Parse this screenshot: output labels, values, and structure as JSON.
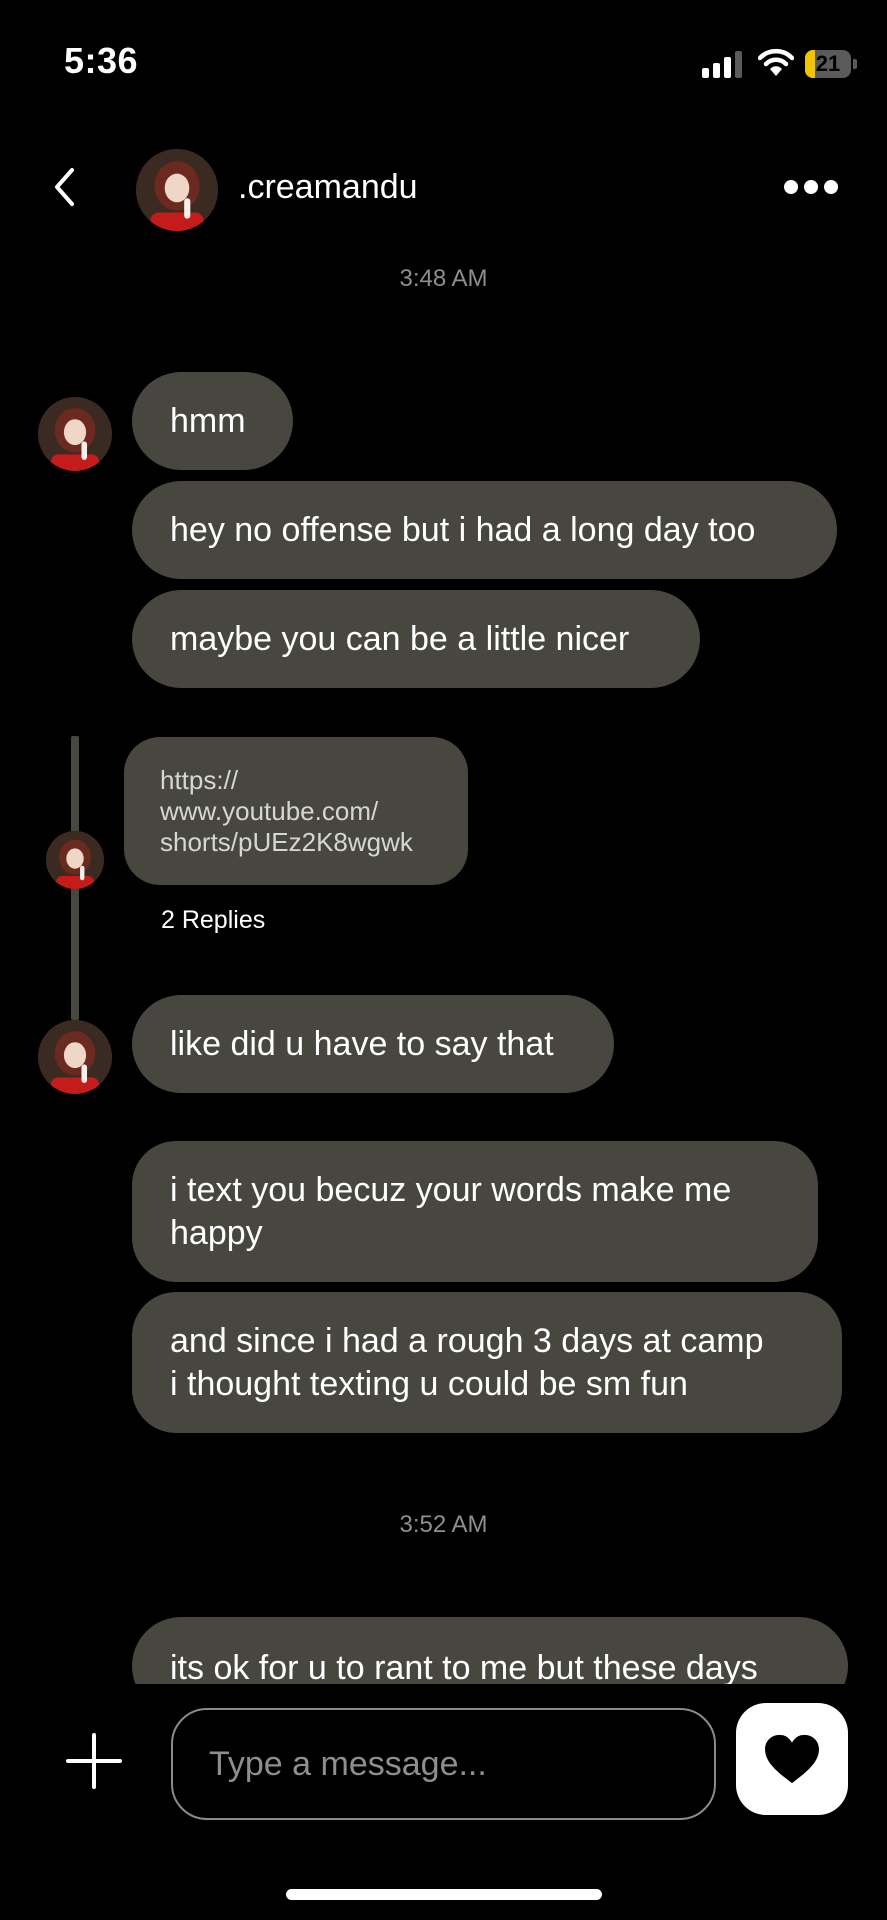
{
  "status_bar": {
    "time": "5:36",
    "battery": "21",
    "battery_level": 0.21,
    "signal_bars": 3
  },
  "header": {
    "username": ".creamandu",
    "back_icon": "chevron-left-icon",
    "more_icon": "more-horizontal-icon"
  },
  "timestamps": [
    "3:48 AM",
    "3:52 AM"
  ],
  "messages": [
    {
      "text": "hmm"
    },
    {
      "text": "hey no offense but i had a long day too"
    },
    {
      "text": "maybe you can be a little nicer"
    },
    {
      "text": "https:// www.youtube.com/ shorts/pUEz2K8wgwk",
      "lines": [
        "https://",
        "www.youtube.com/",
        "shorts/pUEz2K8wgwk"
      ],
      "replies": "2 Replies"
    },
    {
      "text": "like did u have to say that"
    },
    {
      "text": "i text you becuz your words make me happy",
      "lines": [
        "i text you becuz your words make me",
        "happy"
      ]
    },
    {
      "text": "and since i had a rough 3 days at camp i thought texting u could be sm fun",
      "lines": [
        "and since i had a rough 3 days at camp",
        "i thought texting u could be sm fun"
      ]
    },
    {
      "text": "its ok for u to rant to me but these days"
    }
  ],
  "composer": {
    "placeholder": "Type a message...",
    "add_icon": "plus-icon",
    "send_icon": "heart-icon"
  },
  "colors": {
    "bubble": "#47463f",
    "background": "#000000",
    "battery_accent": "#f3c400"
  }
}
